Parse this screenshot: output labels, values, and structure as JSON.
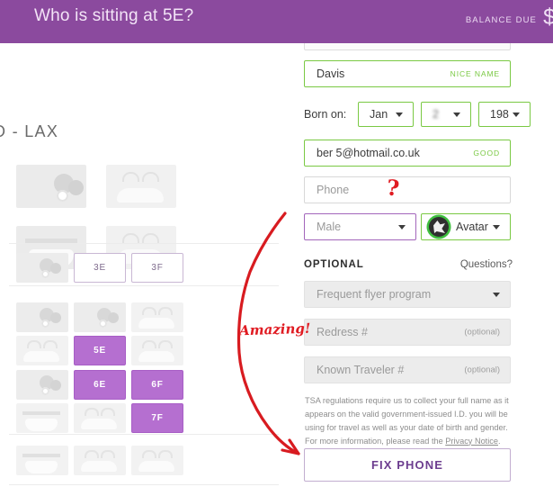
{
  "header": {
    "title": "Who is sitting at 5E?",
    "balance_label": "BALANCE DUE",
    "balance_amount": "$",
    "bg_color": "#8b4a9e"
  },
  "seatmap": {
    "route": "O - LAX",
    "seats": [
      {
        "label": "3E",
        "state": "open"
      },
      {
        "label": "3F",
        "state": "open"
      },
      {
        "label": "5E",
        "state": "taken"
      },
      {
        "label": "6E",
        "state": "taken"
      },
      {
        "label": "6F",
        "state": "taken"
      },
      {
        "label": "7F",
        "state": "taken"
      }
    ],
    "selected_color": "#b56fd0",
    "open_border_color": "#c9b7d4"
  },
  "form": {
    "last_name": {
      "value": "Davis",
      "badge": "NICE NAME",
      "state": "valid"
    },
    "born_on": {
      "label": "Born on:",
      "month": "Jan",
      "day": "2",
      "year": "198",
      "state": "valid"
    },
    "email": {
      "value": "ber        5@hotmail.co.uk",
      "badge": "GOOD",
      "state": "valid"
    },
    "phone": {
      "placeholder": "Phone",
      "value": "",
      "state": "empty"
    },
    "gender": {
      "value": "Male",
      "state": "purple"
    },
    "avatar": {
      "value": "Avatar",
      "state": "valid",
      "icon": "avatar-cat-icon"
    },
    "optional_heading": "OPTIONAL",
    "questions_link": "Questions?",
    "frequent_flyer": {
      "value": "Frequent flyer program"
    },
    "redress": {
      "placeholder": "Redress #",
      "hint": "(optional)"
    },
    "known_traveler": {
      "placeholder": "Known Traveler #",
      "hint": "(optional)"
    },
    "tsa_text_before": "TSA regulations require us to collect your full name as it appears on the valid government-issued I.D. you will be using for travel as well as your date of birth and gender. For more information, please read the ",
    "tsa_link": "Privacy Notice",
    "tsa_text_after": ".",
    "submit_label": "FIX PHONE",
    "valid_color": "#7ac943",
    "purple_color": "#a366bb",
    "submit_text_color": "#6c3d8f"
  },
  "annotations": {
    "amazing_text": "Amazing!",
    "question_mark": "?",
    "ink_color": "#e01b22"
  }
}
